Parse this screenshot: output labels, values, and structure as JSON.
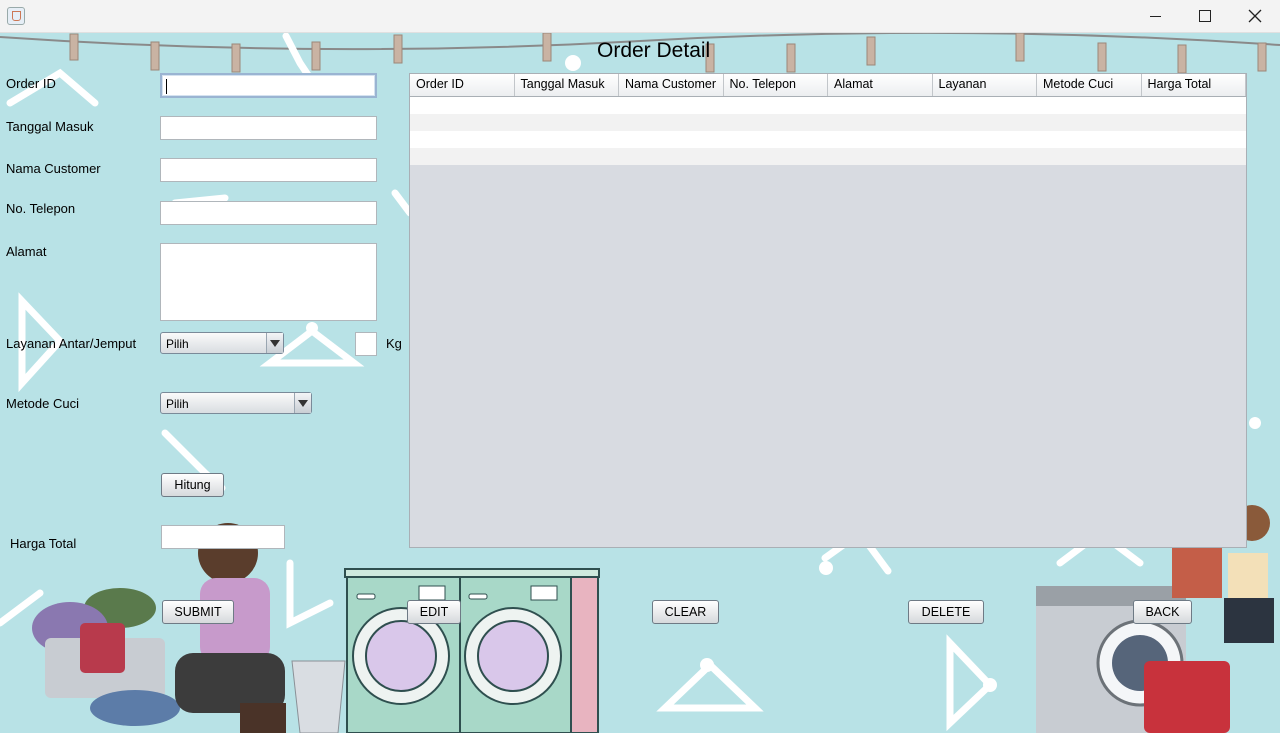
{
  "window": {
    "minimize_label": "",
    "maximize_label": "",
    "close_label": ""
  },
  "page": {
    "title": "Order Detail"
  },
  "form": {
    "order_id_label": "Order ID",
    "order_id_value": "",
    "tanggal_masuk_label": "Tanggal Masuk",
    "nama_customer_label": "Nama Customer",
    "no_telepon_label": "No. Telepon",
    "alamat_label": "Alamat",
    "layanan_label": "Layanan Antar/Jemput",
    "layanan_selected": "Pilih",
    "kg_label": "Kg",
    "metode_label": "Metode Cuci",
    "metode_selected": "Pilih",
    "hitung_label": "Hitung",
    "harga_total_label": "Harga Total"
  },
  "table": {
    "columns": [
      "Order ID",
      "Tanggal Masuk",
      "Nama Customer",
      "No. Telepon",
      "Alamat",
      "Layanan",
      "Metode Cuci",
      "Harga Total"
    ],
    "row_count": 4
  },
  "actions": {
    "submit": "SUBMIT",
    "edit": "EDIT",
    "clear": "CLEAR",
    "delete": "DELETE",
    "back": "BACK"
  },
  "colors": {
    "background": "#b8e2e6",
    "table_bg": "#d8dbe1",
    "machine": "#a8d8c8",
    "accent_pink": "#e8b4c0"
  }
}
